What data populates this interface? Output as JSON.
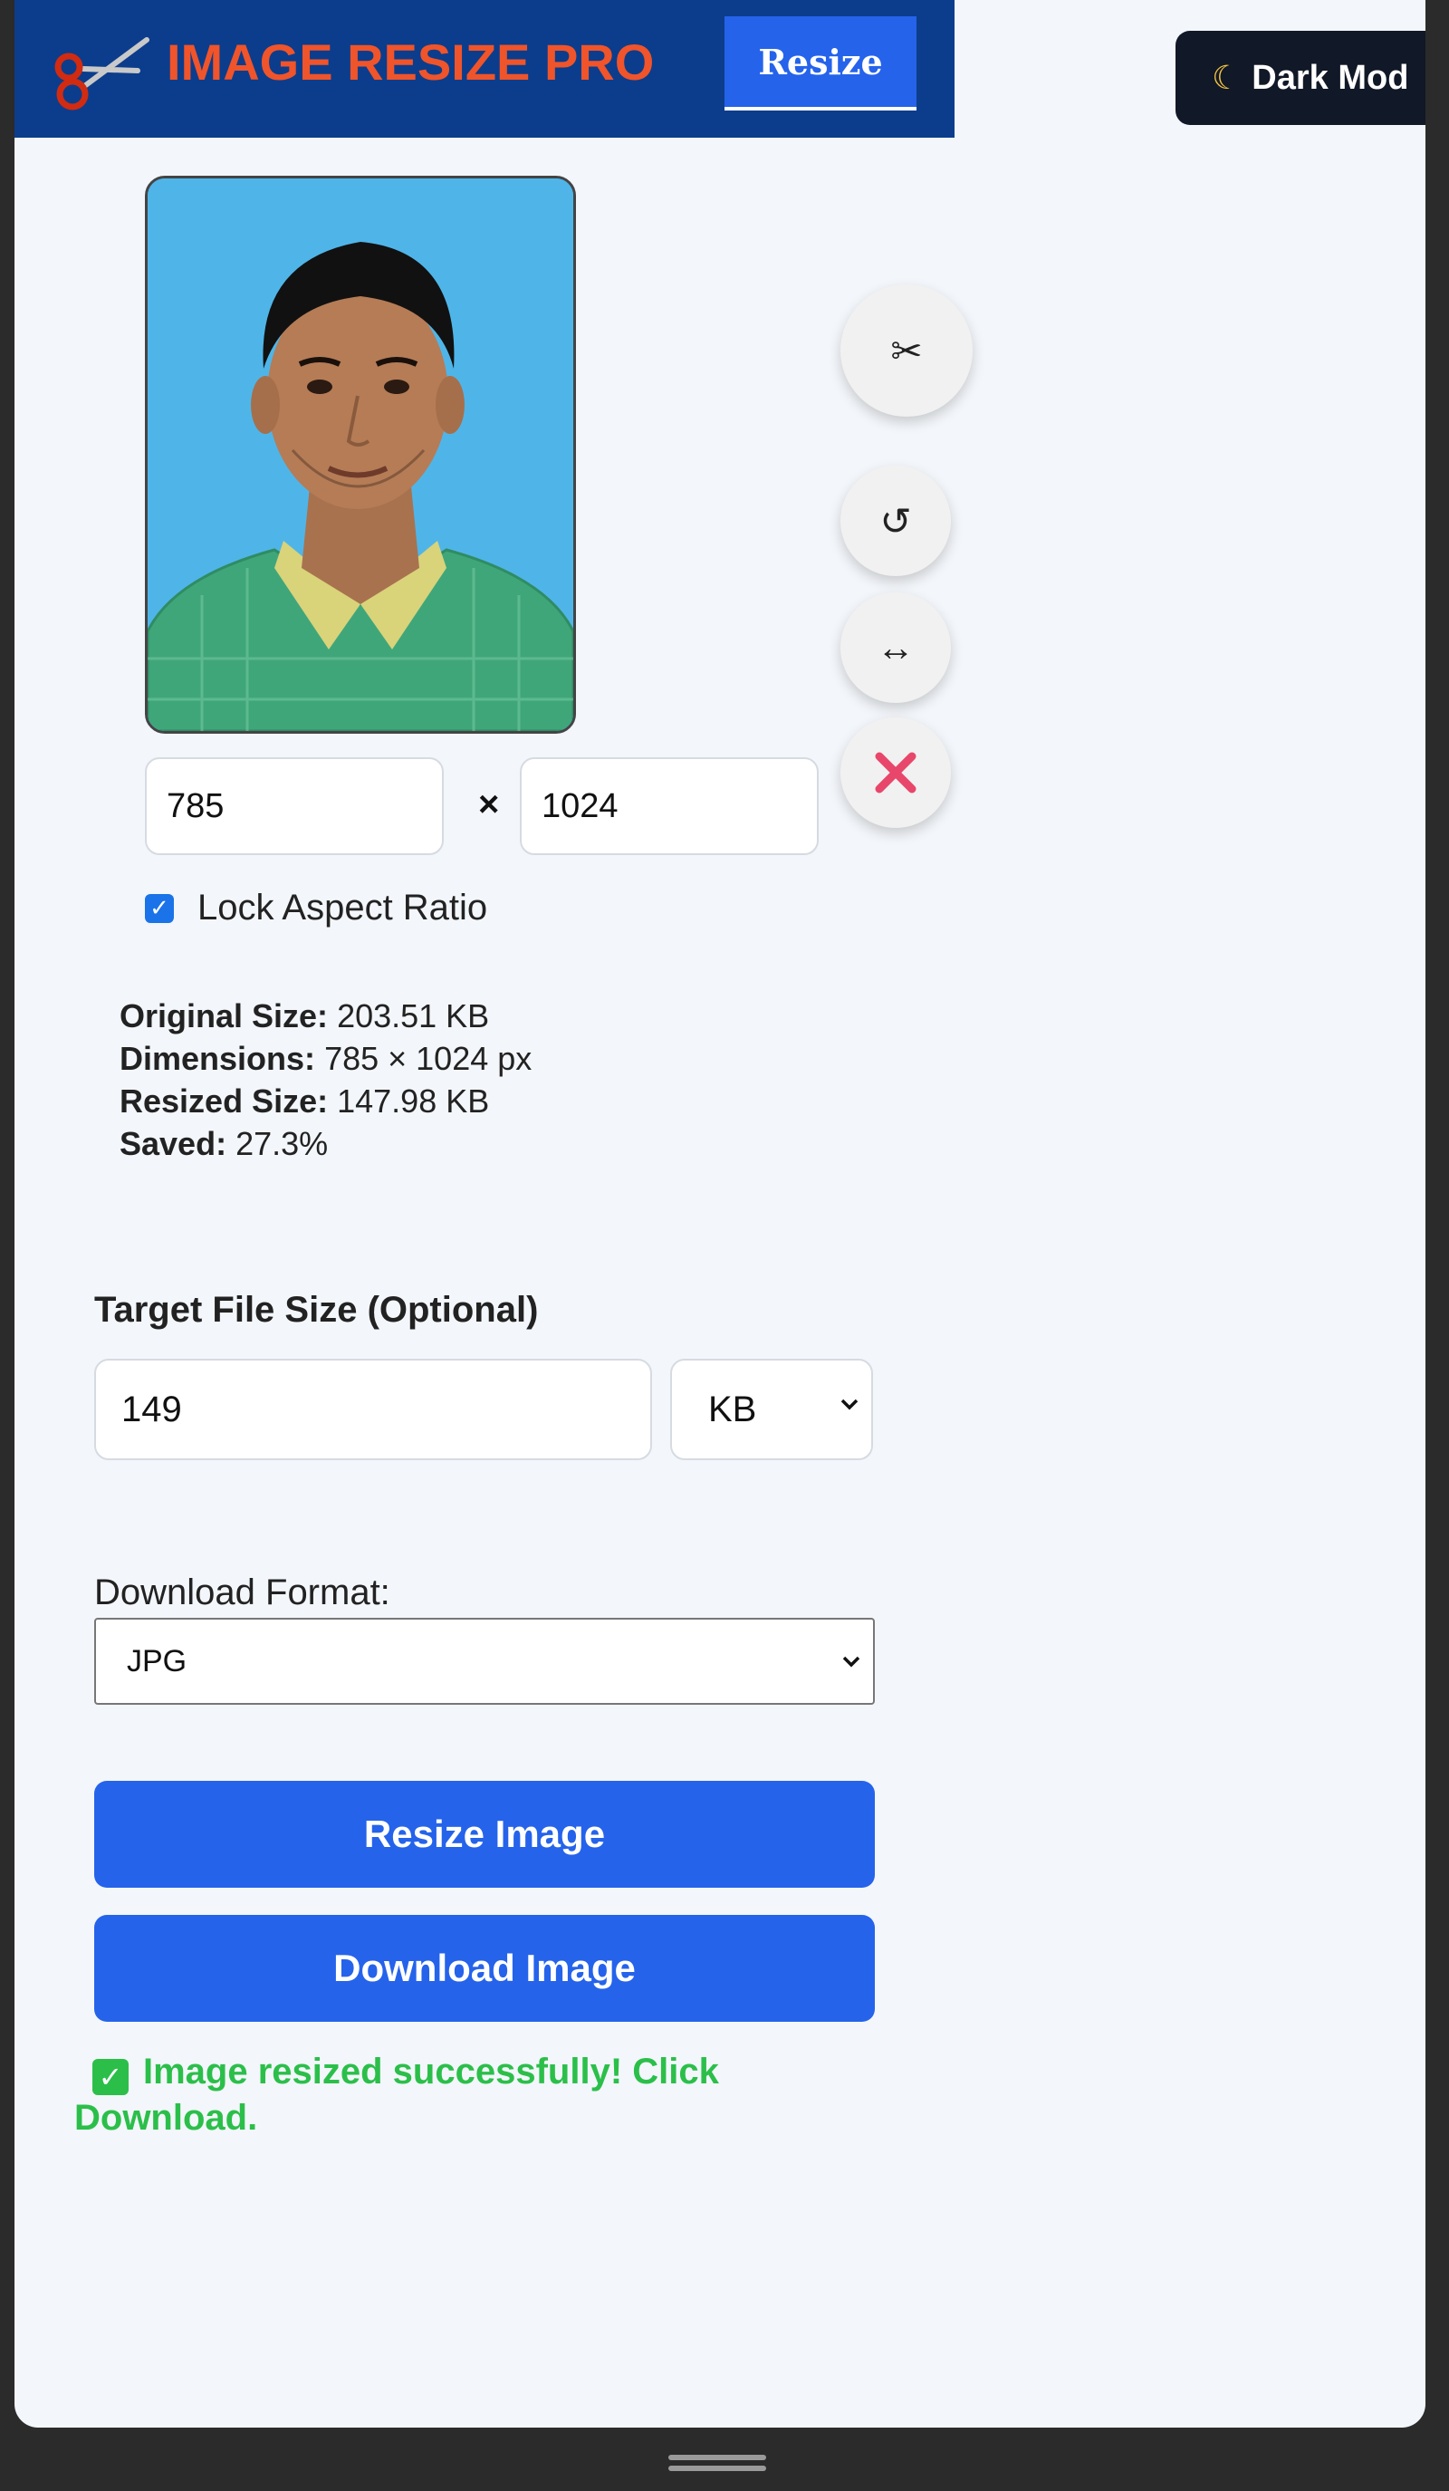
{
  "header": {
    "brand": "IMAGE RESIZE PRO",
    "nav_resize": "Resize",
    "dark_mode": "Dark Mod",
    "brand_color": "#f0542a",
    "header_bg": "#0b3d8c"
  },
  "tools": {
    "crop_icon": "scissors-icon",
    "rotate_icon": "rotate-icon",
    "flip_icon": "flip-horizontal-icon",
    "remove_icon": "close-icon"
  },
  "dimensions": {
    "width": "785",
    "height": "1024",
    "separator": "×",
    "lock_label": "Lock Aspect Ratio",
    "lock_checked": true
  },
  "info": {
    "original_label": "Original Size:",
    "original_value": "203.51 KB",
    "dimensions_label": "Dimensions:",
    "dimensions_value": "785 × 1024 px",
    "resized_label": "Resized Size:",
    "resized_value": "147.98 KB",
    "saved_label": "Saved:",
    "saved_value": "27.3%"
  },
  "target": {
    "label": "Target File Size (Optional)",
    "value": "149",
    "unit": "KB"
  },
  "format": {
    "label": "Download Format:",
    "value": "JPG"
  },
  "actions": {
    "resize": "Resize Image",
    "download": "Download Image"
  },
  "status": {
    "message": "Image resized successfully! Click Download.",
    "color": "#2bbf4a"
  }
}
